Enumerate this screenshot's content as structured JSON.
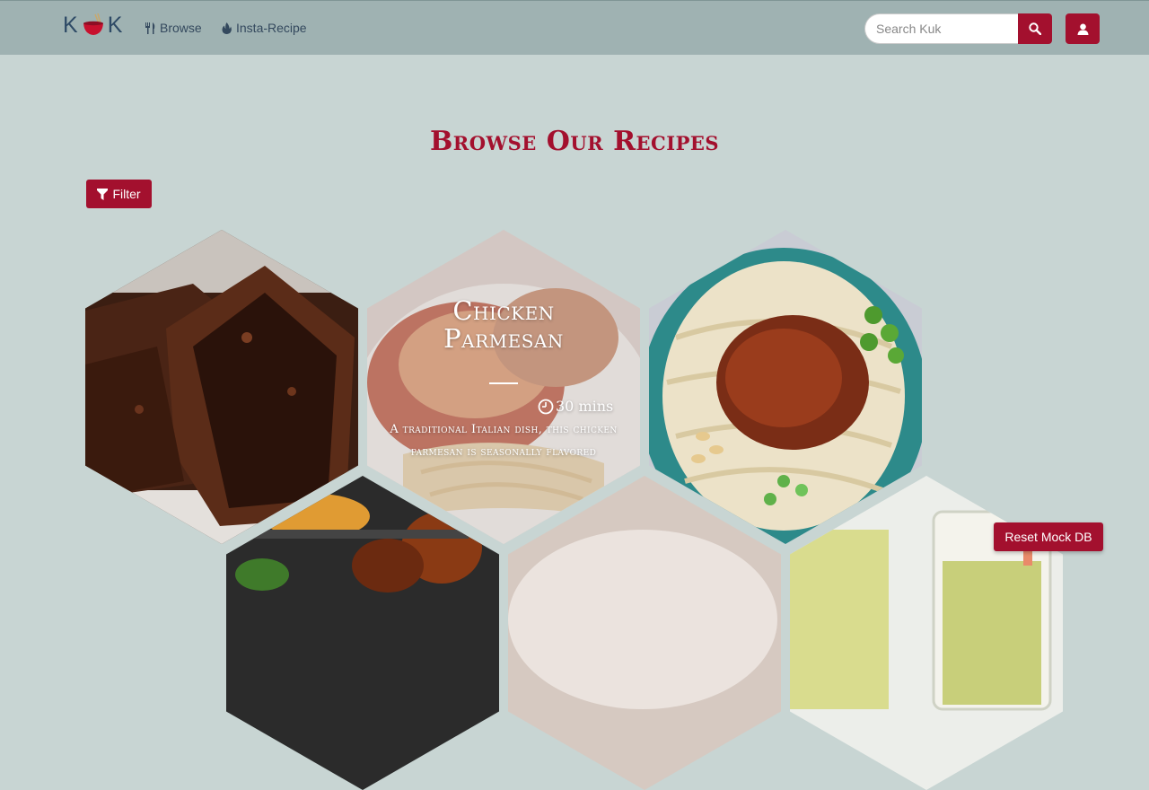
{
  "nav": {
    "logo_left": "K",
    "logo_right": "K",
    "browse_label": "Browse",
    "insta_label": "Insta-Recipe",
    "search_placeholder": "Search Kuk"
  },
  "page": {
    "title": "Browse Our Recipes",
    "filter_label": "Filter",
    "reset_label": "Reset Mock DB"
  },
  "recipes": [
    {
      "image": "brownies"
    },
    {
      "image": "chicken-parmesan",
      "title_line1": "Chicken",
      "title_line2": "Parmesan",
      "time": "30 mins",
      "description": "A traditional Italian dish, this chicken parmesan is seasonally flavored"
    },
    {
      "image": "noodles-with-pork"
    },
    {
      "image": "grilled-skewers"
    },
    {
      "image": "plated-dish"
    },
    {
      "image": "drinks"
    }
  ],
  "colors": {
    "accent": "#a3102e",
    "navbar": "#9fb2b2",
    "background": "#c8d5d3",
    "nav_text": "#34495e"
  }
}
